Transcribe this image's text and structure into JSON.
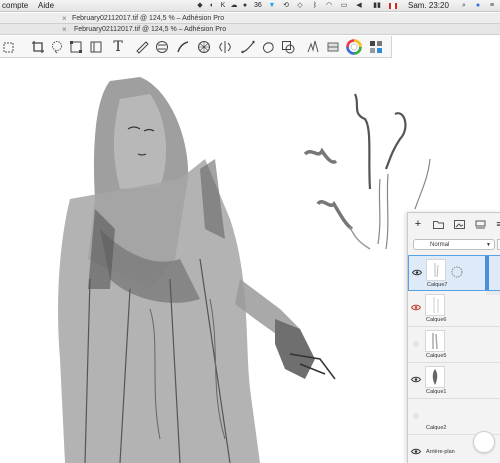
{
  "menubar": {
    "items": [
      "compte",
      "Aide"
    ],
    "notification_count": "36",
    "clock": "Sam. 23:20"
  },
  "tabs": {
    "tab1_title": "February02112017.tif @ 124,5 % – Adhésion Pro",
    "tab2_title": "February02112017.tif @ 124,5 % – Adhésion Pro"
  },
  "toolbar": {
    "icons": [
      "add-layer-icon",
      "crop-icon",
      "lasso-select-icon",
      "transform-icon",
      "perspective-icon",
      "text-icon",
      "ruler-icon",
      "shapes-icon",
      "brush-fx-icon",
      "grid-fill-icon",
      "symmetry-icon",
      "curve-icon",
      "blob-icon",
      "copy-icon",
      "brush-library-icon",
      "eraser-icon",
      "color-wheel-icon",
      "swatches-icon"
    ],
    "accent": "#4a90d9"
  },
  "layers_panel": {
    "blend_mode": "Normal",
    "opacity": "",
    "layers": [
      {
        "name": "Calque7",
        "visible": true,
        "selected": true
      },
      {
        "name": "Calque6",
        "visible": true,
        "selected": false
      },
      {
        "name": "Calque5",
        "visible": false,
        "selected": false
      },
      {
        "name": "Calque1",
        "visible": true,
        "selected": false
      },
      {
        "name": "Calque2",
        "visible": false,
        "selected": false
      },
      {
        "name": "Arrière-plan",
        "visible": true,
        "selected": false
      }
    ]
  }
}
